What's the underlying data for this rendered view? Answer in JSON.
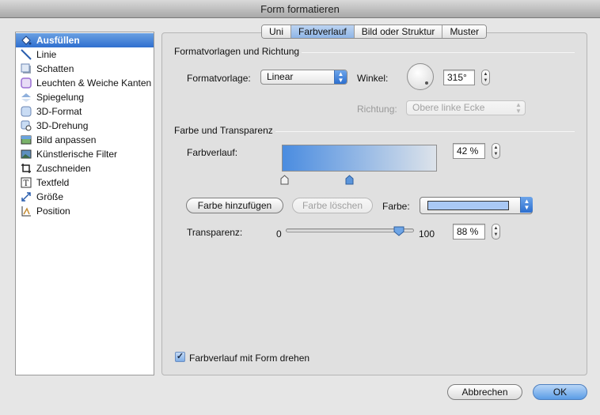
{
  "window": {
    "title": "Form formatieren"
  },
  "sidebar": {
    "items": [
      {
        "label": "Ausfüllen",
        "icon": "paint-bucket-icon",
        "selected": true
      },
      {
        "label": "Linie",
        "icon": "line-icon"
      },
      {
        "label": "Schatten",
        "icon": "shadow-icon"
      },
      {
        "label": "Leuchten & Weiche Kanten",
        "icon": "glow-icon"
      },
      {
        "label": "Spiegelung",
        "icon": "reflection-icon"
      },
      {
        "label": "3D-Format",
        "icon": "3d-format-icon"
      },
      {
        "label": "3D-Drehung",
        "icon": "3d-rotation-icon"
      },
      {
        "label": "Bild anpassen",
        "icon": "adjust-picture-icon"
      },
      {
        "label": "Künstlerische Filter",
        "icon": "artistic-filter-icon"
      },
      {
        "label": "Zuschneiden",
        "icon": "crop-icon"
      },
      {
        "label": "Textfeld",
        "icon": "text-box-icon"
      },
      {
        "label": "Größe",
        "icon": "size-icon"
      },
      {
        "label": "Position",
        "icon": "position-icon"
      }
    ]
  },
  "tabs": [
    {
      "label": "Uni",
      "active": false
    },
    {
      "label": "Farbverlauf",
      "active": true
    },
    {
      "label": "Bild oder Struktur",
      "active": false
    },
    {
      "label": "Muster",
      "active": false
    }
  ],
  "presets": {
    "heading": "Formatvorlagen und Richtung",
    "style_label": "Formatvorlage:",
    "style_value": "Linear",
    "angle_label": "Winkel:",
    "angle_value": "315°",
    "direction_label": "Richtung:",
    "direction_value": "Obere linke Ecke"
  },
  "color_transparency": {
    "heading": "Farbe und Transparenz",
    "gradient_label": "Farbverlauf:",
    "gradient_position": "42 %",
    "gradient_stops": [
      0.0,
      0.42
    ],
    "add_color_label": "Farbe hinzufügen",
    "delete_color_label": "Farbe löschen",
    "color_label": "Farbe:",
    "color_value": "#a9c8f4",
    "transparency_label": "Transparenz:",
    "slider_min": "0",
    "slider_max": "100",
    "transparency_value": "88 %",
    "transparency_level": 88
  },
  "rotate_with_shape": {
    "label": "Farbverlauf mit Form drehen",
    "checked": true
  },
  "footer": {
    "cancel_label": "Abbrechen",
    "ok_label": "OK"
  },
  "colors": {
    "gradient_start": "#4a8ce0",
    "gradient_end": "#dde3ea",
    "selection": "#3a78d4"
  }
}
